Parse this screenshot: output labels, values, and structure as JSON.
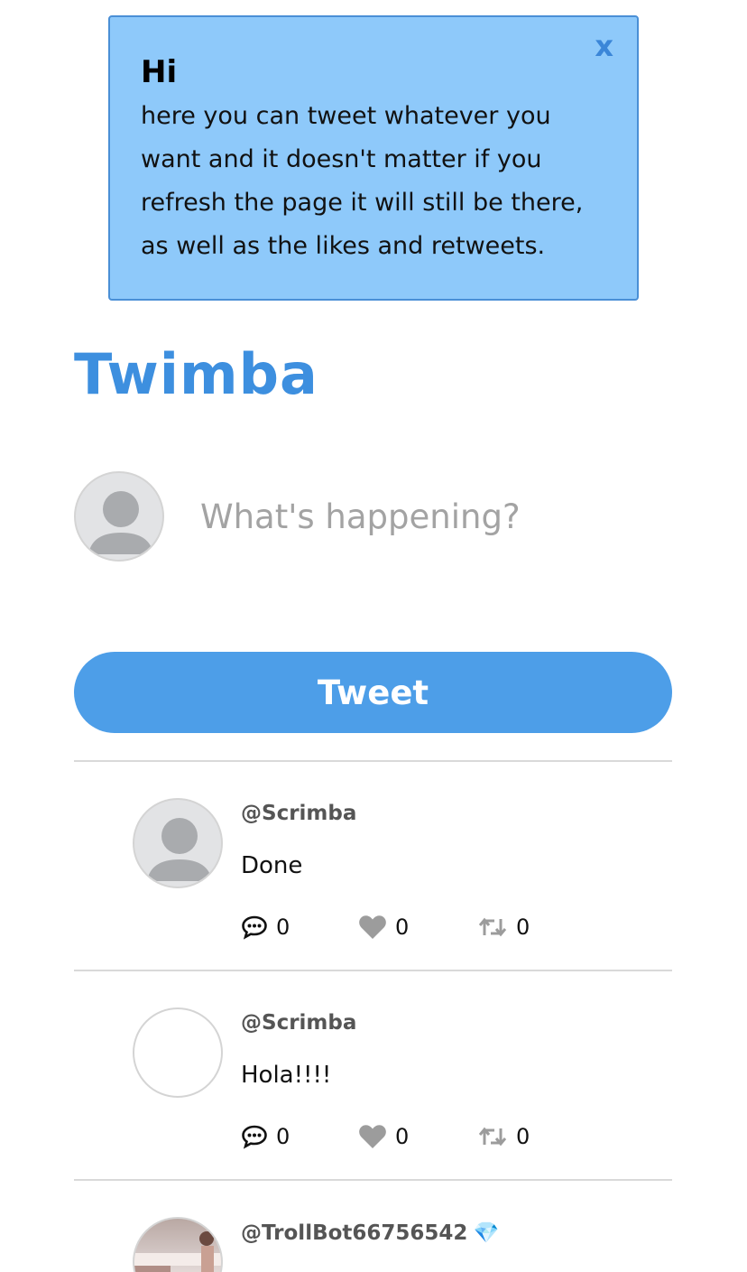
{
  "notice": {
    "title": "Hi",
    "body": "here you can tweet whatever you want and it doesn't matter if you refresh the page it will still be there, as well as the likes and retweets.",
    "close_label": "x"
  },
  "brand": "Twimba",
  "compose": {
    "placeholder": "What's happening?"
  },
  "tweet_button_label": "Tweet",
  "tweets": [
    {
      "handle": "@Scrimba",
      "text": "Done",
      "replies": "0",
      "likes": "0",
      "retweets": "0"
    },
    {
      "handle": "@Scrimba",
      "text": "Hola!!!!",
      "replies": "0",
      "likes": "0",
      "retweets": "0"
    },
    {
      "handle": "@TrollBot66756542",
      "badge": "💎"
    }
  ],
  "colors": {
    "accent": "#4d9ee8",
    "brand": "#3d8fdf",
    "notice_bg": "#8ec9fa",
    "icon_gray": "#9c9c9c"
  },
  "icons": {
    "reply": "comment-dots-icon",
    "like": "heart-icon",
    "retweet": "retweet-icon",
    "avatar": "default-user-avatar"
  }
}
